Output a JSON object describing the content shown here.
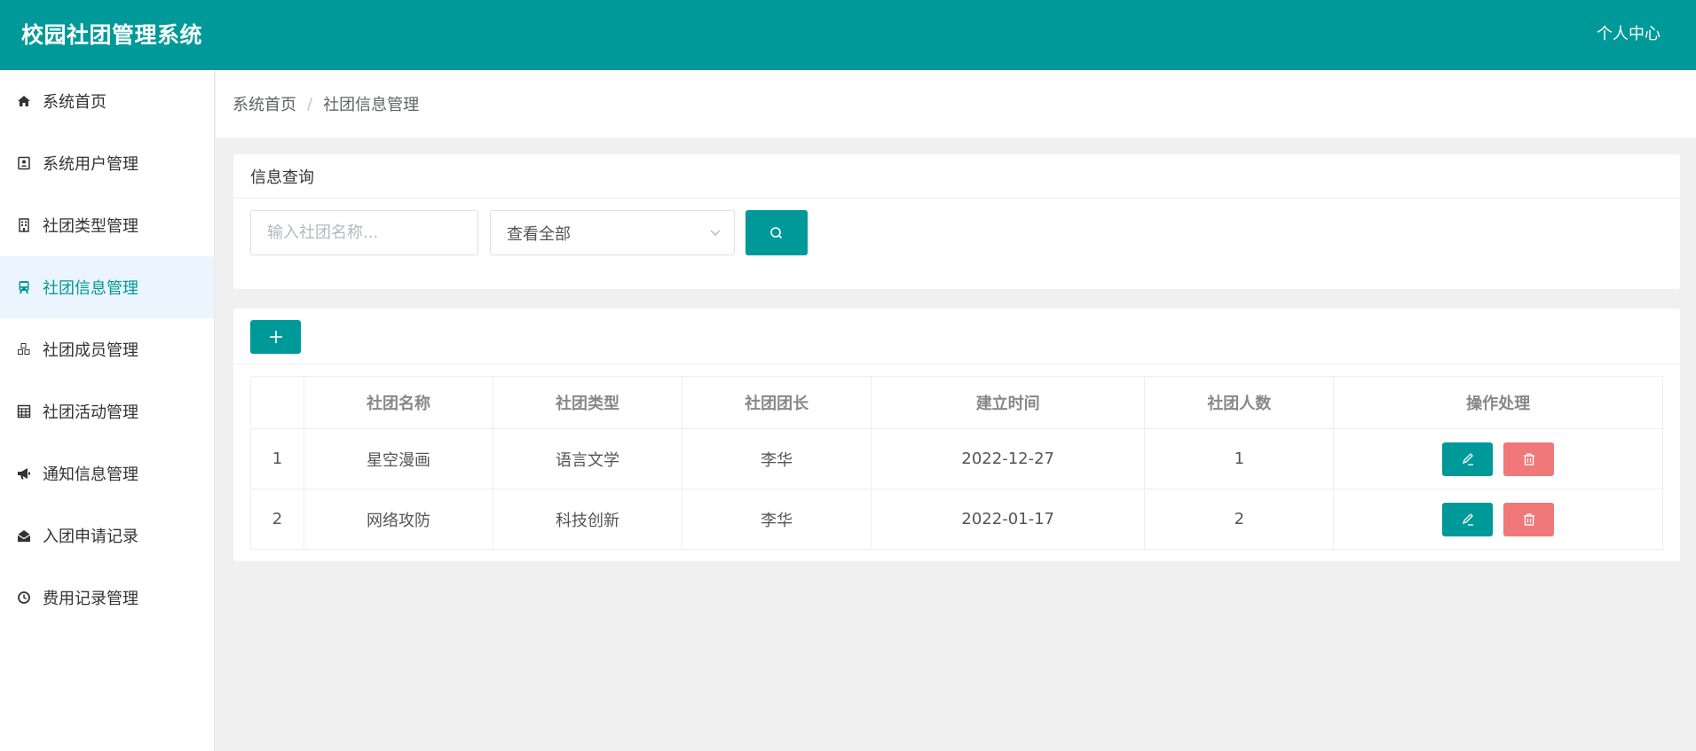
{
  "header": {
    "title": "校园社团管理系统",
    "user_center": "个人中心"
  },
  "sidebar": {
    "items": [
      {
        "label": "系统首页",
        "icon": "home-icon"
      },
      {
        "label": "系统用户管理",
        "icon": "user-card-icon"
      },
      {
        "label": "社团类型管理",
        "icon": "building-icon"
      },
      {
        "label": "社团信息管理",
        "icon": "bus-icon",
        "active": true
      },
      {
        "label": "社团成员管理",
        "icon": "cubes-icon"
      },
      {
        "label": "社团活动管理",
        "icon": "calculator-icon"
      },
      {
        "label": "通知信息管理",
        "icon": "bullhorn-icon"
      },
      {
        "label": "入团申请记录",
        "icon": "envelope-open-icon"
      },
      {
        "label": "费用记录管理",
        "icon": "clock-icon"
      }
    ]
  },
  "breadcrumb": {
    "home": "系统首页",
    "separator": "/",
    "current": "社团信息管理"
  },
  "search": {
    "title": "信息查询",
    "placeholder": "输入社团名称...",
    "select_value": "查看全部"
  },
  "table": {
    "headers": [
      "",
      "社团名称",
      "社团类型",
      "社团团长",
      "建立时间",
      "社团人数",
      "操作处理"
    ],
    "rows": [
      {
        "index": "1",
        "name": "星空漫画",
        "type": "语言文学",
        "leader": "李华",
        "date": "2022-12-27",
        "count": "1"
      },
      {
        "index": "2",
        "name": "网络攻防",
        "type": "科技创新",
        "leader": "李华",
        "date": "2022-01-17",
        "count": "2"
      }
    ]
  },
  "colors": {
    "primary": "#009999",
    "danger": "#f07878",
    "active_bg": "#ecf5ff"
  }
}
